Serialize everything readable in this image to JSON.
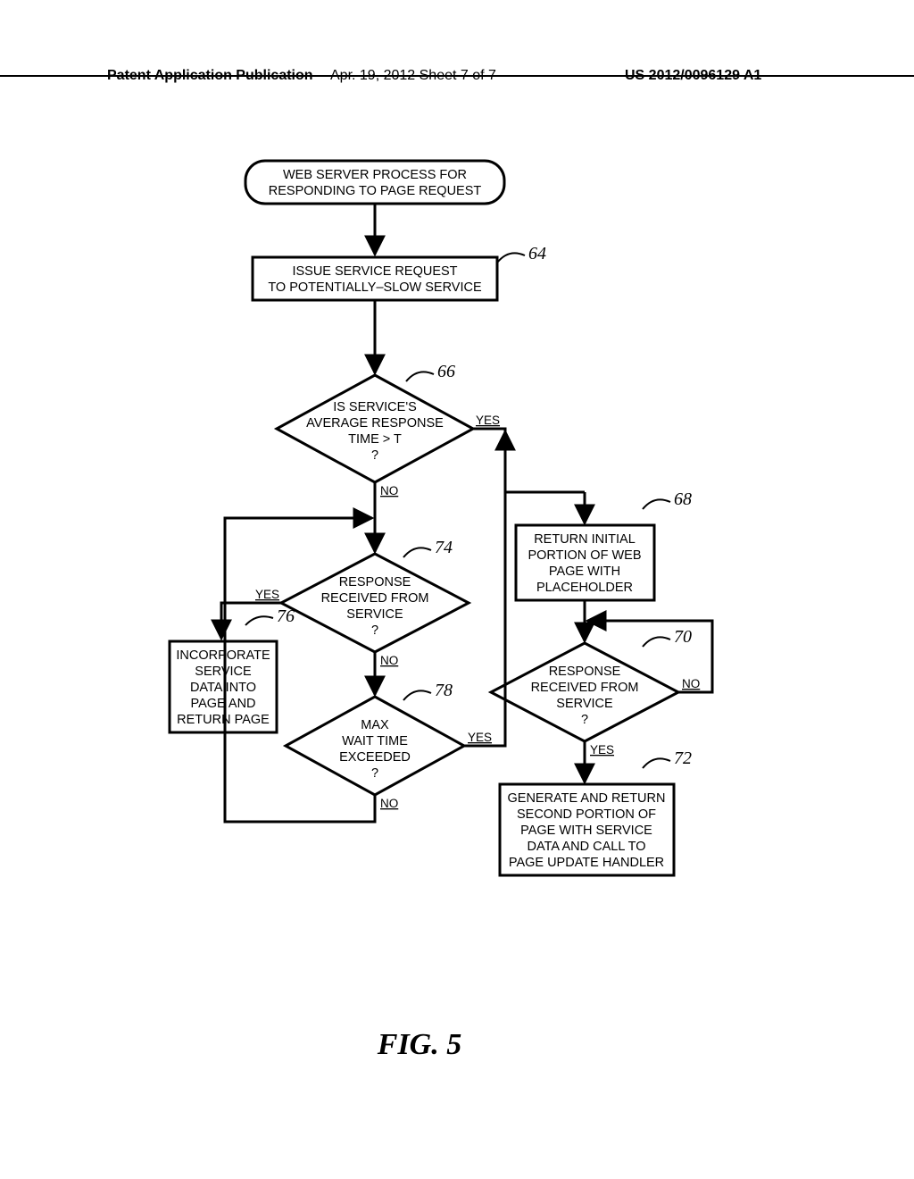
{
  "header": {
    "left": "Patent Application Publication",
    "mid": "Apr. 19, 2012  Sheet 7 of 7",
    "right": "US 2012/0096129 A1"
  },
  "nodes": {
    "terminator": {
      "line1": "WEB SERVER PROCESS FOR",
      "line2": "RESPONDING TO PAGE REQUEST"
    },
    "b64": {
      "ref": "64",
      "line1": "ISSUE SERVICE REQUEST",
      "line2": "TO POTENTIALLY–SLOW SERVICE"
    },
    "d66": {
      "ref": "66",
      "line1": "IS SERVICE'S",
      "line2": "AVERAGE RESPONSE",
      "line3": "TIME  >  T",
      "line4": "?"
    },
    "b68": {
      "ref": "68",
      "line1": "RETURN INITIAL",
      "line2": "PORTION OF WEB",
      "line3": "PAGE WITH",
      "line4": "PLACEHOLDER"
    },
    "d70": {
      "ref": "70",
      "line1": "RESPONSE",
      "line2": "RECEIVED FROM",
      "line3": "SERVICE",
      "line4": "?"
    },
    "b72": {
      "ref": "72",
      "line1": "GENERATE AND RETURN",
      "line2": "SECOND PORTION OF",
      "line3": "PAGE WITH SERVICE",
      "line4": "DATA AND CALL TO",
      "line5": "PAGE UPDATE HANDLER"
    },
    "d74": {
      "ref": "74",
      "line1": "RESPONSE",
      "line2": "RECEIVED FROM",
      "line3": "SERVICE",
      "line4": "?"
    },
    "b76": {
      "ref": "76",
      "line1": "INCORPORATE",
      "line2": "SERVICE",
      "line3": "DATA INTO",
      "line4": "PAGE AND",
      "line5": "RETURN PAGE"
    },
    "d78": {
      "ref": "78",
      "line1": "MAX",
      "line2": "WAIT TIME",
      "line3": "EXCEEDED",
      "line4": "?"
    }
  },
  "labels": {
    "yes": "YES",
    "no": "NO"
  },
  "figure": "FIG.   5"
}
